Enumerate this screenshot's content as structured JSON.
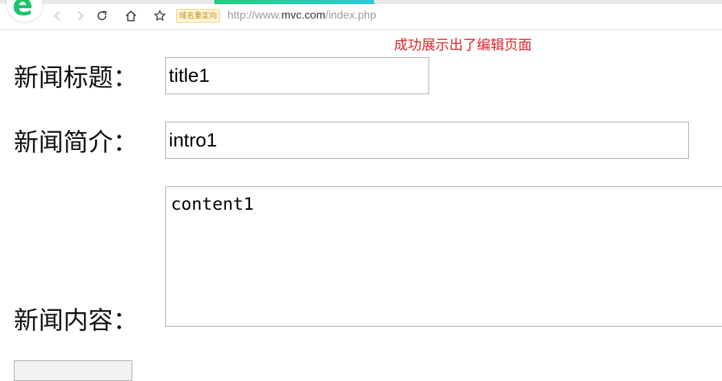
{
  "browser": {
    "badge": "域名重定向",
    "url_prefix": "http://www.",
    "url_domain": "mvc.com",
    "url_path": "/index.php",
    "accent_color": "#1fd17a"
  },
  "icons": {
    "logo": "browser-logo-e",
    "back": "chevron-left-icon",
    "forward": "chevron-right-icon",
    "reload": "reload-icon",
    "home": "home-icon",
    "favorite": "star-icon"
  },
  "page": {
    "notice": "成功展示出了编辑页面",
    "notice_color": "#e0252b",
    "form": {
      "title_label": "新闻标题：",
      "title_value": "title1",
      "intro_label": "新闻简介：",
      "intro_value": "intro1",
      "content_label": "新闻内容：",
      "content_value": "content1"
    }
  }
}
